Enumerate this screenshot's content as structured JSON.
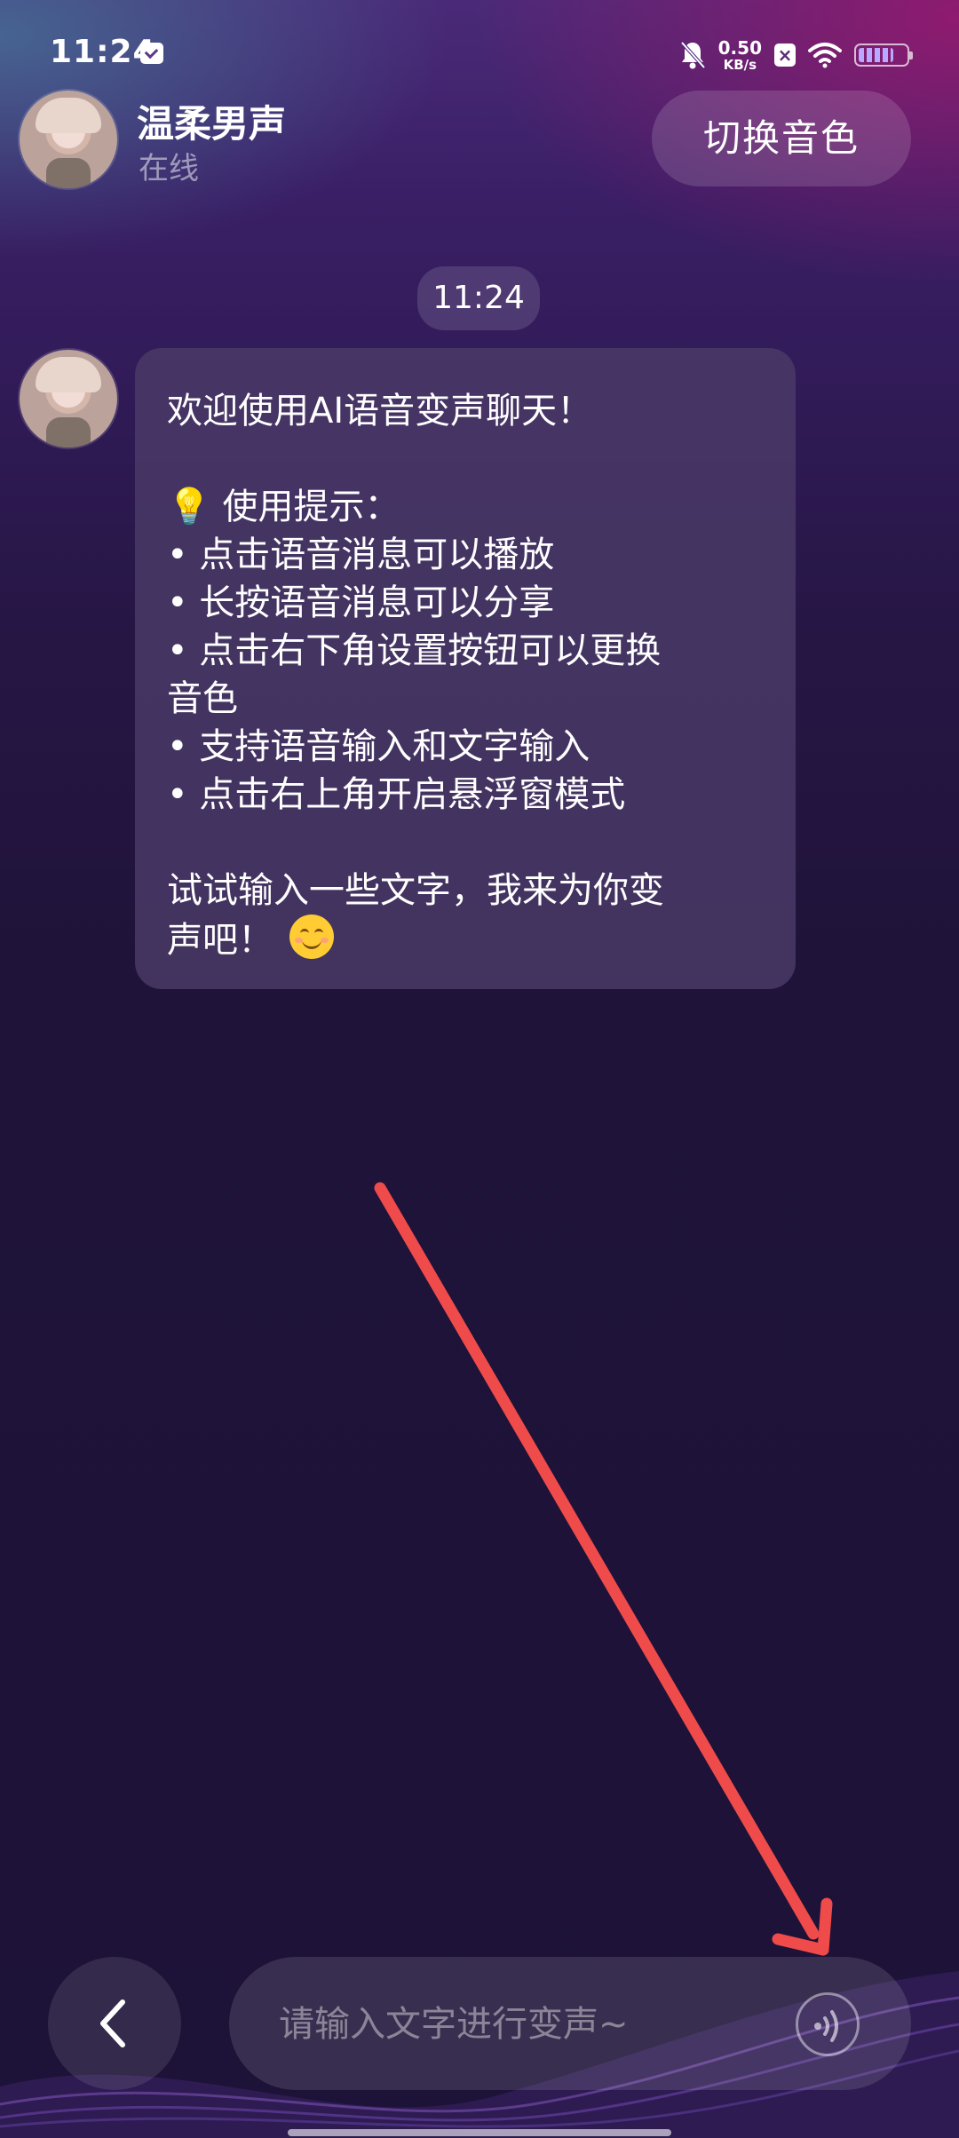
{
  "status_bar": {
    "time": "11:24",
    "net_speed_value": "0.50",
    "net_speed_unit": "KB/s",
    "x_badge": "×",
    "battery_level": 0.75,
    "icons": [
      "message-icon",
      "mute-bell-icon",
      "wifi-icon",
      "battery-icon"
    ]
  },
  "header": {
    "name": "温柔男声",
    "status": "在线",
    "switch_button": "切换音色"
  },
  "chat": {
    "time_chip": "11:24",
    "message": {
      "line1": "欢迎使用AI语音变声聊天！",
      "tips_title": "使用提示：",
      "tip1": "• 点击语音消息可以播放",
      "tip2": "• 长按语音消息可以分享",
      "tip3a": "• 点击右下角设置按钮可以更换",
      "tip3b": "音色",
      "tip4": "• 支持语音输入和文字输入",
      "tip5": "• 点击右上角开启悬浮窗模式",
      "closing_a": "试试输入一些文字，我来为你变",
      "closing_b": "声吧！",
      "emojis": [
        "lightbulb",
        "smiling-face"
      ]
    }
  },
  "input_bar": {
    "placeholder": "请输入文字进行变声~",
    "value": ""
  },
  "colors": {
    "annotation_arrow": "#ef4b4b",
    "background": "#1f1339",
    "bubble": "#4a3a68"
  }
}
